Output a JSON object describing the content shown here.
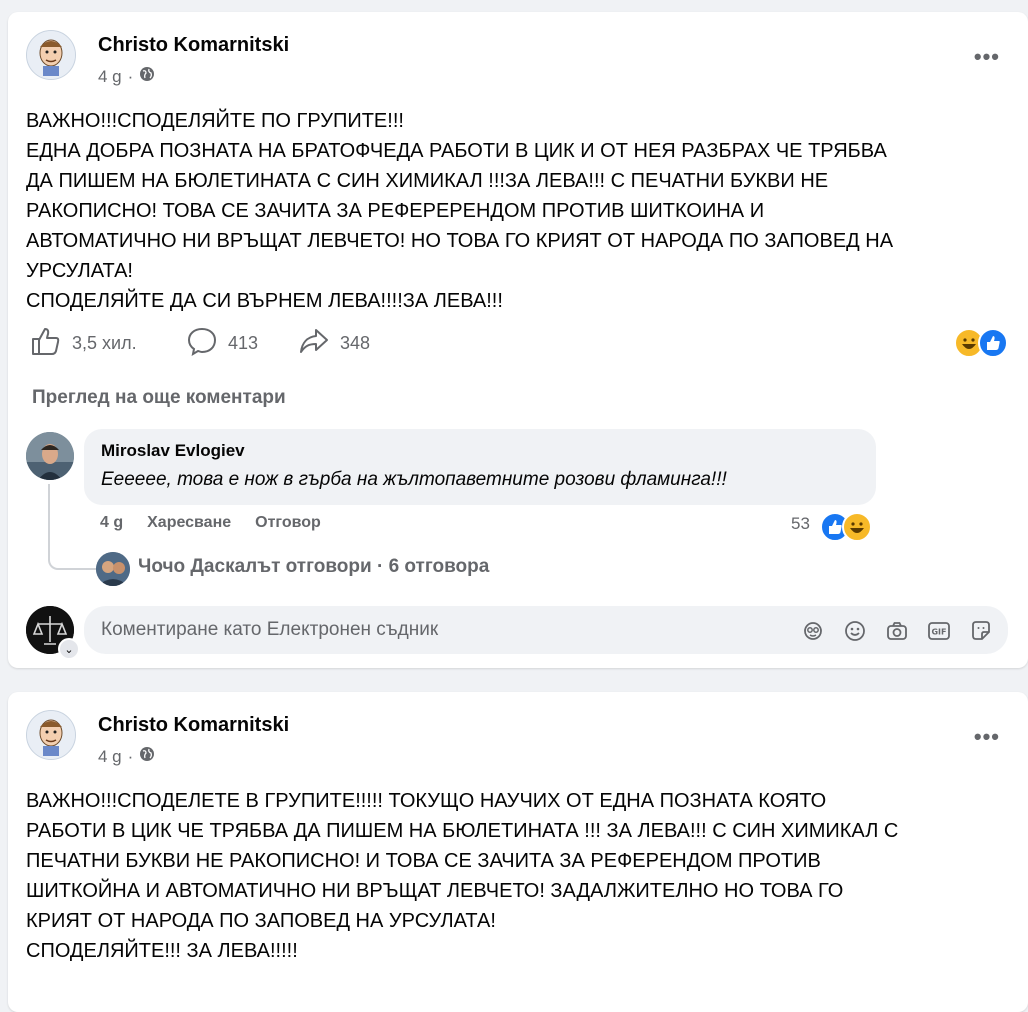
{
  "posts": [
    {
      "author": "Christo Komarnitski",
      "time": "4 g",
      "lines": [
        "ВАЖНО!!!СПОДЕЛЯЙТЕ ПО ГРУПИТЕ!!!",
        "ЕДНА ДОБРА ПОЗНАТА НА БРАТОФЧЕДА РАБОТИ В ЦИК И ОТ НЕЯ РАЗБРАХ ЧЕ ТРЯБВА",
        "ДА ПИШЕМ НА БЮЛЕТИНАТА С СИН ХИМИКАЛ !!!ЗА ЛЕВА!!! С ПЕЧАТНИ БУКВИ НЕ",
        "РАКОПИСНО! ТОВА СЕ ЗАЧИТА ЗА РЕФЕРЕРЕНДОМ ПРОТИВ ШИТКОИНА И",
        "АВТОМАТИЧНО НИ ВРЪЩАТ ЛЕВЧЕТО! НО ТОВА ГО КРИЯТ ОТ НАРОДА ПО ЗАПОВЕД НА",
        "УРСУЛАТА!",
        "СПОДЕЛЯЙТЕ ДА СИ ВЪРНЕМ ЛЕВА!!!!ЗА ЛЕВА!!!"
      ],
      "likes": "3,5 хил.",
      "comments": "413",
      "shares": "348"
    },
    {
      "author": "Christo Komarnitski",
      "time": "4 g",
      "lines": [
        "ВАЖНО!!!СПОДЕЛЕТЕ В ГРУПИТЕ!!!!! ТОКУЩО НАУЧИХ ОТ ЕДНА ПОЗНАТА КОЯТО",
        "РАБОТИ В ЦИК ЧЕ ТРЯБВА ДА ПИШЕМ НА БЮЛЕТИНАТА !!! ЗА ЛЕВА!!! С СИН ХИМИКАЛ С",
        "ПЕЧАТНИ БУКВИ НЕ РАКОПИСНО! И ТОВА СЕ ЗАЧИТА ЗА РЕФЕРЕНДОМ ПРОТИВ",
        "ШИТКОЙНА И АВТОМАТИЧНО НИ ВРЪЩАТ ЛЕВЧЕТО! ЗАДАЛЖИТЕЛНО НО ТОВА ГО",
        "КРИЯТ ОТ НАРОДА ПО ЗАПОВЕД НА УРСУЛАТА!",
        "СПОДЕЛЯЙТЕ!!! ЗА ЛЕВА!!!!!"
      ]
    }
  ],
  "comments_section": {
    "view_more": "Преглед на още коментари",
    "comment": {
      "author": "Miroslav Evlogiev",
      "text": "Ееееее, това е нож в гърба на жълтопаветните розови фламинга!!!",
      "time": "4 g",
      "like_label": "Харесване",
      "reply_label": "Отговор",
      "reaction_count": "53"
    },
    "reply_summary": "Чочо Даскалът отговори · 6 отговора",
    "composer_placeholder": "Коментиране като Електронен съдник"
  },
  "colors": {
    "like_blue": "#1877f2",
    "haha_yellow": "#f7b928",
    "secondary_text": "#65676b"
  },
  "icons": [
    "globe-icon",
    "more-icon",
    "like-icon",
    "comment-icon",
    "share-icon",
    "avatar-sticker-icon",
    "emoji-icon",
    "camera-icon",
    "gif-icon",
    "sticker-icon"
  ]
}
